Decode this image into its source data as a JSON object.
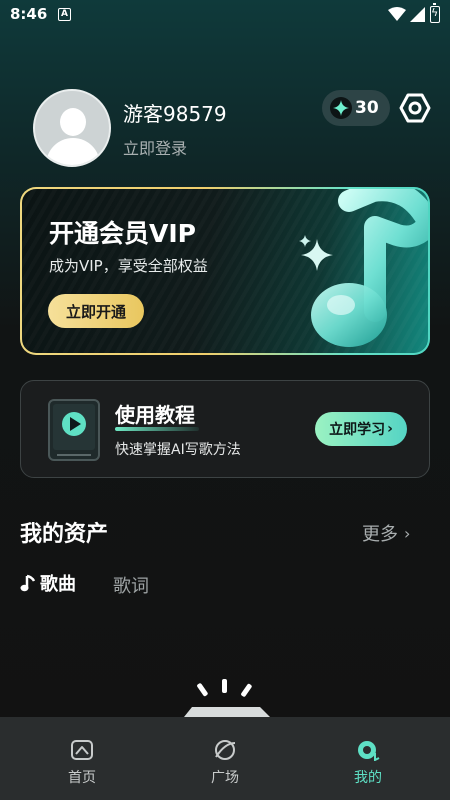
{
  "status_bar": {
    "time": "8:46",
    "notification_glyph": "A"
  },
  "profile": {
    "username": "游客98579",
    "login_link": "立即登录",
    "points": "30"
  },
  "vip_card": {
    "title": "开通会员VIP",
    "subtitle": "成为VIP，享受全部权益",
    "button_label": "立即开通"
  },
  "tutorial_card": {
    "title": "使用教程",
    "subtitle": "快速掌握AI写歌方法",
    "button_label": "立即学习",
    "button_arrow": "›"
  },
  "assets": {
    "title": "我的资产",
    "more_label": "更多",
    "more_arrow": "›",
    "tabs": [
      {
        "label": "歌曲",
        "active": true
      },
      {
        "label": "歌词",
        "active": false
      }
    ]
  },
  "bottom_nav": {
    "items": [
      {
        "label": "首页",
        "icon": "home-icon",
        "active": false
      },
      {
        "label": "广场",
        "icon": "plaza-icon",
        "active": false
      },
      {
        "label": "我的",
        "icon": "my-music-icon",
        "active": true
      }
    ]
  },
  "colors": {
    "accent": "#5ee0c5",
    "vip_gold": "#efd87f",
    "background": "#121212",
    "nav_background": "#2a2d2e"
  }
}
